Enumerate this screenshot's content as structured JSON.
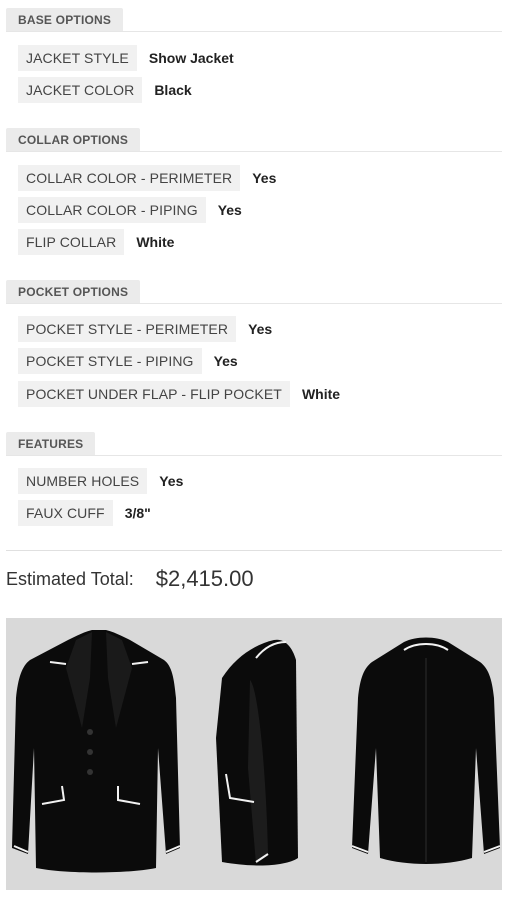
{
  "sections": [
    {
      "title": "BASE OPTIONS",
      "items": [
        {
          "label": "JACKET STYLE",
          "value": "Show Jacket"
        },
        {
          "label": "JACKET COLOR",
          "value": "Black"
        }
      ]
    },
    {
      "title": "COLLAR OPTIONS",
      "items": [
        {
          "label": "COLLAR COLOR - PERIMETER",
          "value": "Yes"
        },
        {
          "label": "COLLAR COLOR - PIPING",
          "value": "Yes"
        },
        {
          "label": "FLIP COLLAR",
          "value": "White"
        }
      ]
    },
    {
      "title": "POCKET OPTIONS",
      "items": [
        {
          "label": "POCKET STYLE - PERIMETER",
          "value": "Yes"
        },
        {
          "label": "POCKET STYLE - PIPING",
          "value": "Yes"
        },
        {
          "label": "POCKET UNDER FLAP - FLIP POCKET",
          "value": "White"
        }
      ]
    },
    {
      "title": "FEATURES",
      "items": [
        {
          "label": "NUMBER HOLES",
          "value": "Yes"
        },
        {
          "label": "FAUX CUFF",
          "value": "3/8\""
        }
      ]
    }
  ],
  "total": {
    "label": "Estimated Total:",
    "value": "$2,415.00"
  },
  "preview": {
    "views": [
      "front",
      "side",
      "back"
    ],
    "jacket_color": "#0b0b0b",
    "trim_color": "#f2f2f2",
    "background": "#d9d9d9"
  }
}
